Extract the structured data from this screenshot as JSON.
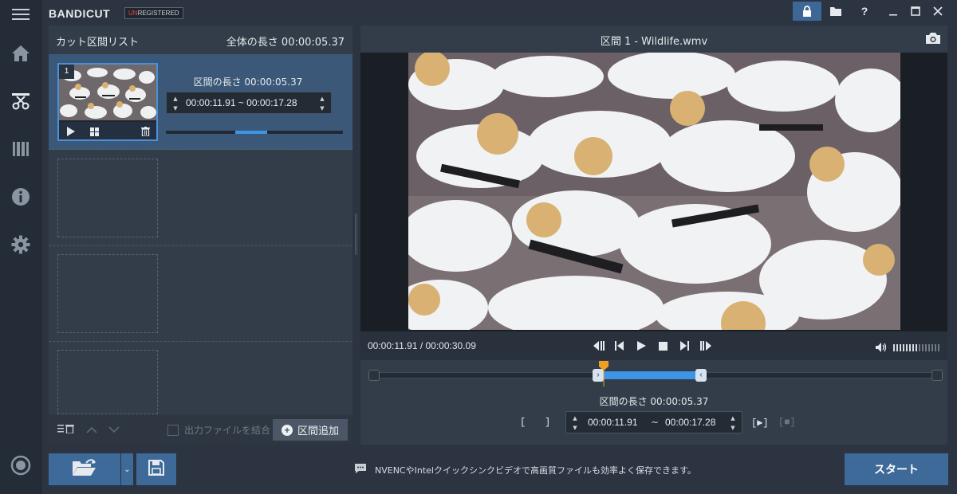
{
  "app": {
    "brand": "BANDICUT",
    "badge_un": "UN",
    "badge_rest": "REGISTERED"
  },
  "titlebar": {
    "help": "?"
  },
  "sidebar": {
    "items": [
      {
        "name": "menu-icon"
      },
      {
        "name": "home-icon"
      },
      {
        "name": "cut-icon"
      },
      {
        "name": "film-join-icon"
      },
      {
        "name": "info-icon"
      },
      {
        "name": "settings-icon"
      },
      {
        "name": "record-icon"
      }
    ]
  },
  "cut_list": {
    "title": "カット区間リスト",
    "total": "全体の長さ 00:00:05.37",
    "segment": {
      "number": "1",
      "length": "区間の長さ 00:00:05.37",
      "range": "00:00:11.91 ~ 00:00:17.28"
    },
    "merge_label": "出力ファイルを結合",
    "add_label": "区間追加"
  },
  "preview": {
    "title": "区間 1 - Wildlife.wmv",
    "time": "00:00:11.91 / 00:00:30.09",
    "segment_length": "区間の長さ 00:00:05.37",
    "start_time": "00:00:11.91",
    "tilde": "~",
    "end_time": "00:00:17.28",
    "bracket_open": "[",
    "bracket_close": "]",
    "play_range": "[▶]",
    "volume_level": 0.55
  },
  "bottom": {
    "tip": "NVENCやIntelクイックシンクビデオで高画質ファイルも効率よく保存できます。",
    "start": "スタート"
  },
  "colors": {
    "accent": "#3d6a99",
    "selection": "#3c95e6",
    "playhead": "#f0a020"
  }
}
